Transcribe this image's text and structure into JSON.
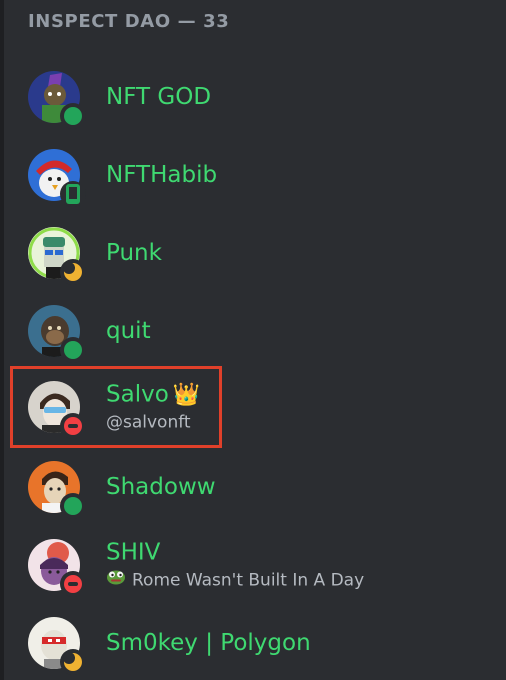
{
  "header": {
    "title": "INSPECT DAO — 33"
  },
  "members": [
    {
      "name": "NFT GOD",
      "status": "online",
      "subtext": "",
      "crown": "",
      "activity_icon": ""
    },
    {
      "name": "NFTHabib",
      "status": "mobile",
      "subtext": "",
      "crown": "",
      "activity_icon": ""
    },
    {
      "name": "Punk",
      "status": "idle",
      "subtext": "",
      "crown": "",
      "activity_icon": ""
    },
    {
      "name": "quit",
      "status": "online",
      "subtext": "",
      "crown": "",
      "activity_icon": ""
    },
    {
      "name": "Salvo",
      "status": "dnd",
      "subtext": "@salvonft",
      "crown": "👑",
      "activity_icon": ""
    },
    {
      "name": "Shadoww",
      "status": "online",
      "subtext": "",
      "crown": "",
      "activity_icon": ""
    },
    {
      "name": "SHIV",
      "status": "dnd",
      "subtext": "Rome Wasn't Built In A Day",
      "crown": "",
      "activity_icon": "pepe-emoji-icon"
    },
    {
      "name": "Sm0key | Polygon",
      "status": "idle",
      "subtext": "",
      "crown": "",
      "activity_icon": ""
    }
  ],
  "colors": {
    "background": "#2b2d31",
    "name_green": "#3fd971",
    "header_gray": "#949ba4",
    "online": "#23a55a",
    "idle": "#f0b232",
    "dnd": "#f23f43",
    "highlight_box": "#e0402a"
  }
}
